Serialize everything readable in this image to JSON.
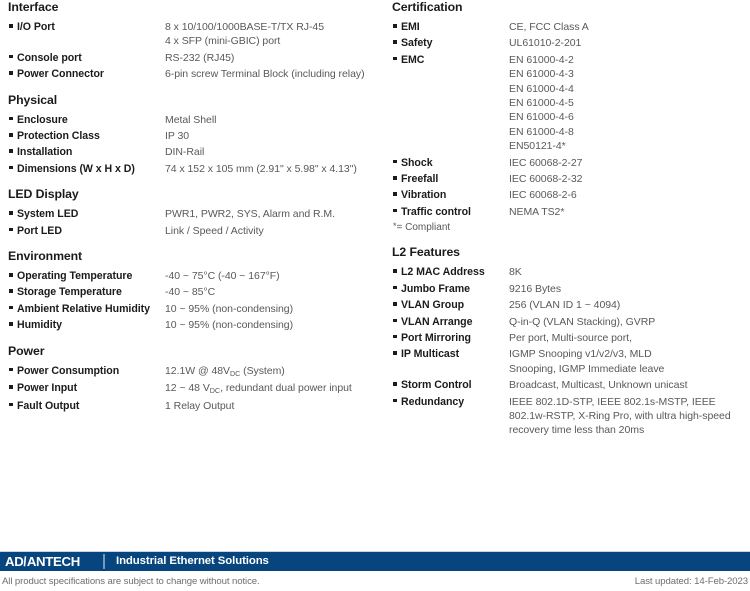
{
  "document": {
    "type": "product-specification-sheet",
    "accent_color": "#06457d",
    "label_color": "#1b1b1b",
    "value_color": "#58595b"
  },
  "left_column": {
    "sections": [
      {
        "title": "Interface",
        "rows": [
          {
            "label": "I/O Port",
            "lines": [
              "8 x 10/100/1000BASE-T/TX RJ-45",
              "4 x SFP (mini-GBIC) port"
            ]
          },
          {
            "label": "Console port",
            "lines": [
              "RS-232 (RJ45)"
            ]
          },
          {
            "label": "Power Connector",
            "lines": [
              "6-pin screw Terminal Block (including relay)"
            ]
          }
        ]
      },
      {
        "title": "Physical",
        "rows": [
          {
            "label": "Enclosure",
            "lines": [
              "Metal Shell"
            ]
          },
          {
            "label": "Protection Class",
            "lines": [
              "IP 30"
            ]
          },
          {
            "label": "Installation",
            "lines": [
              "DIN-Rail"
            ]
          },
          {
            "label": "Dimensions (W x H x D)",
            "lines": [
              "74 x 152 x 105 mm (2.91\" x 5.98\" x 4.13\")"
            ]
          }
        ]
      },
      {
        "title": "LED Display",
        "rows": [
          {
            "label": "System LED",
            "lines": [
              "PWR1, PWR2, SYS, Alarm and R.M."
            ]
          },
          {
            "label": "Port LED",
            "lines": [
              "Link / Speed / Activity"
            ]
          }
        ]
      },
      {
        "title": "Environment",
        "rows": [
          {
            "label": "Operating Temperature",
            "lines": [
              "-40 ~ 75°C (-40 ~ 167°F)"
            ]
          },
          {
            "label": "Storage Temperature",
            "lines": [
              "-40 ~ 85°C"
            ]
          },
          {
            "label": "Ambient Relative Humidity",
            "lines": [
              "10 ~ 95% (non-condensing)"
            ]
          },
          {
            "label": "Humidity",
            "lines": [
              "10 ~ 95% (non-condensing)"
            ]
          }
        ]
      },
      {
        "title": "Power",
        "rows": [
          {
            "label": "Power Consumption",
            "lines": [
              "12.1W @ 48V|DC| (System)"
            ]
          },
          {
            "label": "Power Input",
            "lines": [
              "12 ~ 48 V|DC|, redundant dual power input"
            ]
          },
          {
            "label": "Fault Output",
            "lines": [
              "1 Relay Output"
            ]
          }
        ]
      }
    ]
  },
  "right_column": {
    "sections": [
      {
        "title": "Certification",
        "rows": [
          {
            "label": "EMI",
            "lines": [
              "CE, FCC Class A"
            ]
          },
          {
            "label": "Safety",
            "lines": [
              "UL61010-2-201"
            ]
          },
          {
            "label": "EMC",
            "lines": [
              "EN 61000-4-2",
              "EN 61000-4-3",
              "EN 61000-4-4",
              "EN 61000-4-5",
              "EN 61000-4-6",
              "EN 61000-4-8",
              "EN50121-4*"
            ]
          },
          {
            "label": "Shock",
            "lines": [
              "IEC 60068-2-27"
            ]
          },
          {
            "label": "Freefall",
            "lines": [
              "IEC 60068-2-32"
            ]
          },
          {
            "label": "Vibration",
            "lines": [
              "IEC 60068-2-6"
            ]
          },
          {
            "label": "Traffic control",
            "lines": [
              "NEMA TS2*"
            ]
          }
        ],
        "note": "*= Compliant"
      },
      {
        "title": "L2 Features",
        "rows": [
          {
            "label": "L2 MAC Address",
            "lines": [
              "8K"
            ]
          },
          {
            "label": "Jumbo Frame",
            "lines": [
              "9216 Bytes"
            ]
          },
          {
            "label": "VLAN Group",
            "lines": [
              "256 (VLAN ID 1 ~ 4094)"
            ]
          },
          {
            "label": "VLAN Arrange",
            "lines": [
              "Q-in-Q (VLAN Stacking), GVRP"
            ]
          },
          {
            "label": "Port Mirroring",
            "lines": [
              "Per port, Multi-source port,"
            ]
          },
          {
            "label": "IP Multicast",
            "lines": [
              "IGMP Snooping v1/v2/v3, MLD",
              "Snooping, IGMP Immediate leave"
            ]
          },
          {
            "label": "Storm Control",
            "lines": [
              "Broadcast, Multicast, Unknown unicast"
            ]
          },
          {
            "label": "Redundancy",
            "lines": [
              "IEEE 802.1D-STP, IEEE 802.1s-MSTP, IEEE",
              "802.1w-RSTP, X-Ring Pro, with ultra high-speed",
              "recovery time less than 20ms"
            ]
          }
        ]
      }
    ]
  },
  "footer": {
    "brand": "ADVANTECH",
    "brand_part_1": "AD",
    "brand_slash": "\\",
    "brand_part_2": "ANTECH",
    "tagline": "Industrial Ethernet Solutions",
    "disclaimer": "All product specifications are subject to change without notice.",
    "last_updated": "Last updated: 14-Feb-2023"
  }
}
